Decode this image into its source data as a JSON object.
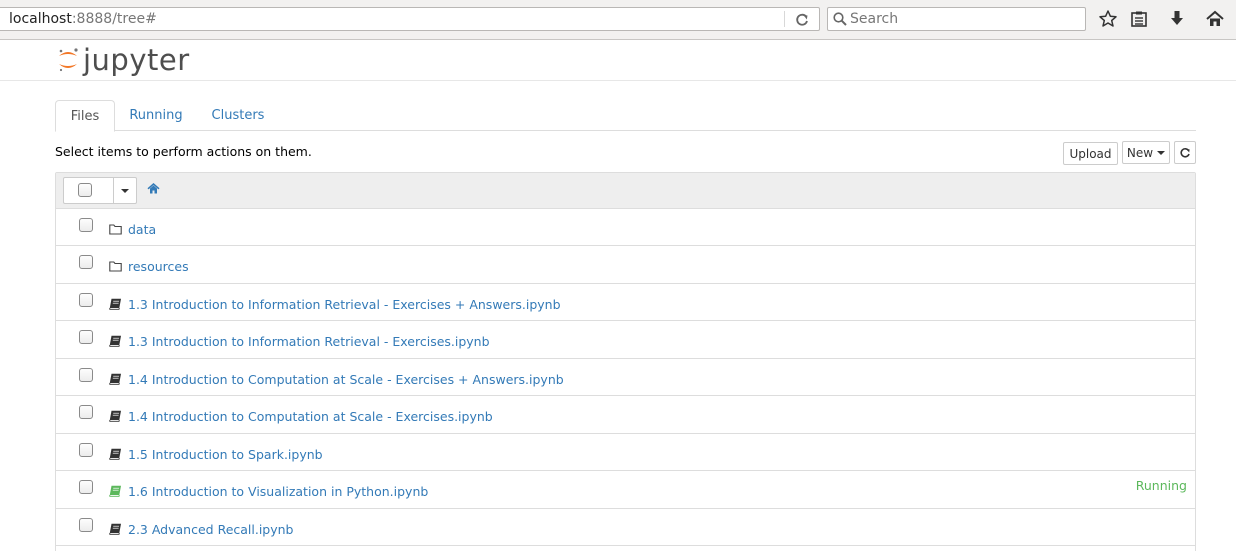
{
  "browser": {
    "url_host": "localhost",
    "url_rest": ":8888/tree#",
    "search_placeholder": "Search"
  },
  "header": {
    "logo_text": "jupyter"
  },
  "tabs": [
    {
      "label": "Files",
      "active": true
    },
    {
      "label": "Running",
      "active": false
    },
    {
      "label": "Clusters",
      "active": false
    }
  ],
  "toolbar": {
    "hint": "Select items to perform actions on them.",
    "upload_label": "Upload",
    "new_label": "New"
  },
  "files": [
    {
      "name": "data",
      "type": "folder",
      "status": ""
    },
    {
      "name": "resources",
      "type": "folder",
      "status": ""
    },
    {
      "name": "1.3 Introduction to Information Retrieval - Exercises + Answers.ipynb",
      "type": "notebook",
      "status": ""
    },
    {
      "name": "1.3 Introduction to Information Retrieval - Exercises.ipynb",
      "type": "notebook",
      "status": ""
    },
    {
      "name": "1.4 Introduction to Computation at Scale - Exercises + Answers.ipynb",
      "type": "notebook",
      "status": ""
    },
    {
      "name": "1.4 Introduction to Computation at Scale - Exercises.ipynb",
      "type": "notebook",
      "status": ""
    },
    {
      "name": "1.5 Introduction to Spark.ipynb",
      "type": "notebook",
      "status": ""
    },
    {
      "name": "1.6 Introduction to Visualization in Python.ipynb",
      "type": "notebook-running",
      "status": "Running"
    },
    {
      "name": "2.3 Advanced Recall.ipynb",
      "type": "notebook",
      "status": ""
    }
  ],
  "colors": {
    "link": "#337ab7",
    "running": "#5cb85c",
    "logo_orange": "#f37726"
  }
}
